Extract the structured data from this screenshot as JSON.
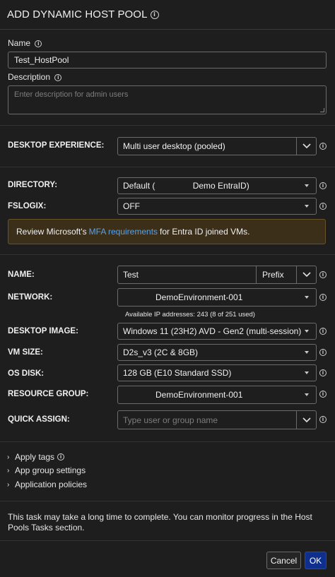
{
  "header": {
    "title": "ADD DYNAMIC HOST POOL"
  },
  "name_field": {
    "label": "Name",
    "value": "Test_HostPool"
  },
  "description_field": {
    "label": "Description",
    "placeholder": "Enter description for admin users"
  },
  "desktop_experience": {
    "label": "DESKTOP EXPERIENCE:",
    "value": "Multi user desktop (pooled)"
  },
  "directory": {
    "label": "DIRECTORY:",
    "value": "Default (                Demo EntraID)"
  },
  "fslogix": {
    "label": "FSLOGIX:",
    "value": "OFF"
  },
  "banner": {
    "prefix": "Review Microsoft's",
    "link": "MFA requirements",
    "suffix": "for Entra ID joined VMs."
  },
  "name_setting": {
    "label": "NAME:",
    "value": "Test",
    "mode": "Prefix"
  },
  "network": {
    "label": "NETWORK:",
    "value": "DemoEnvironment-001",
    "note": "Available IP addresses: 243 (8 of 251 used)"
  },
  "desktop_image": {
    "label": "DESKTOP IMAGE:",
    "value": "Windows 11 (23H2) AVD - Gen2 (multi-session)"
  },
  "vm_size": {
    "label": "VM SIZE:",
    "value": "D2s_v3 (2C & 8GB)"
  },
  "os_disk": {
    "label": "OS DISK:",
    "value": "128 GB (E10 Standard SSD)"
  },
  "resource_group": {
    "label": "RESOURCE GROUP:",
    "value": "DemoEnvironment-001"
  },
  "quick_assign": {
    "label": "QUICK ASSIGN:",
    "placeholder": "Type user or group name"
  },
  "expanders": {
    "apply_tags": "Apply tags",
    "app_group_settings": "App group settings",
    "application_policies": "Application policies"
  },
  "footer_note": "This task may take a long time to complete. You can monitor progress in the Host Pools Tasks section.",
  "buttons": {
    "cancel": "Cancel",
    "ok": "OK"
  },
  "colors": {
    "background": "#1e1e1e",
    "link": "#5aa0e6",
    "banner_bg": "#3b2f1a",
    "ok_button": "#0f2f8f"
  }
}
